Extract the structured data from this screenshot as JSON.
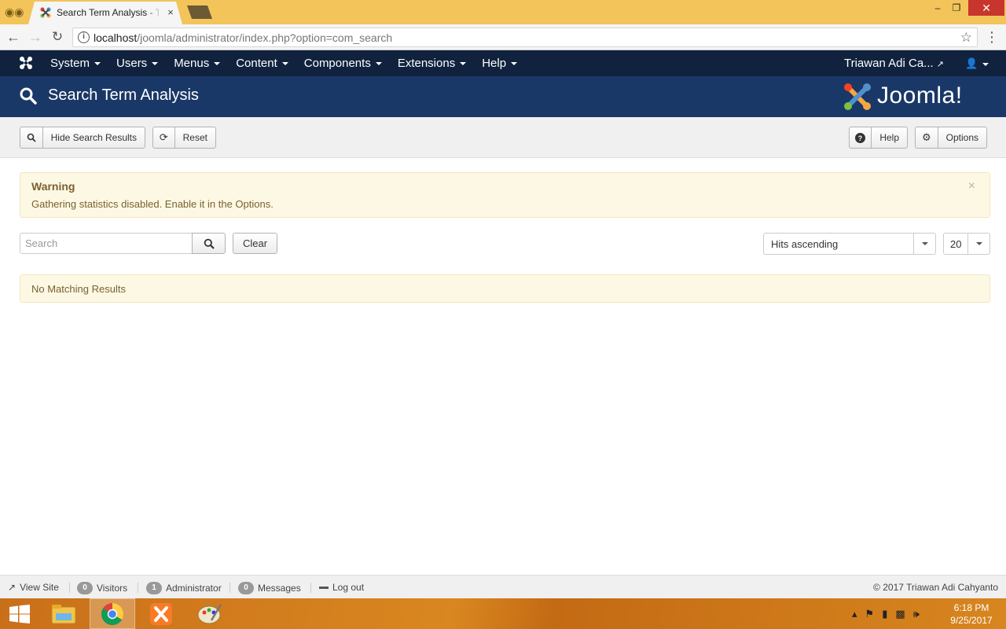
{
  "browser": {
    "tab_title": "Search Term Analysis - Tr",
    "tab_close": "×",
    "url_host": "localhost",
    "url_path": "/joomla/administrator/index.php?option=com_search",
    "window_controls": {
      "minimize": "–",
      "maximize": "❐",
      "close": "✕"
    }
  },
  "adminnav": {
    "items": [
      {
        "label": "System"
      },
      {
        "label": "Users"
      },
      {
        "label": "Menus"
      },
      {
        "label": "Content"
      },
      {
        "label": "Components"
      },
      {
        "label": "Extensions"
      },
      {
        "label": "Help"
      }
    ],
    "user_name": "Triawan Adi Ca..."
  },
  "header": {
    "title": "Search Term Analysis",
    "brand": "Joomla!"
  },
  "toolbar": {
    "hide_label": "Hide Search Results",
    "reset_label": "Reset",
    "help_label": "Help",
    "options_label": "Options"
  },
  "alert": {
    "heading": "Warning",
    "message": "Gathering statistics disabled. Enable it in the Options.",
    "close": "×"
  },
  "filters": {
    "search_placeholder": "Search",
    "clear_label": "Clear",
    "ordering_value": "Hits ascending",
    "limit_value": "20"
  },
  "results": {
    "empty_message": "No Matching Results"
  },
  "statusbar": {
    "view_site": "View Site",
    "visitors_count": "0",
    "visitors_label": "Visitors",
    "admin_count": "1",
    "admin_label": "Administrator",
    "messages_count": "0",
    "messages_label": "Messages",
    "logout_label": "Log out",
    "copyright": "© 2017 Triawan Adi Cahyanto"
  },
  "taskbar": {
    "time": "6:18 PM",
    "date": "9/25/2017"
  },
  "colors": {
    "admin_nav_bg": "#10223e",
    "header_bg": "#1a3867",
    "warning_bg": "#fcf8e3",
    "warning_text": "#7b6132",
    "chrome_frame": "#f2c45a"
  }
}
